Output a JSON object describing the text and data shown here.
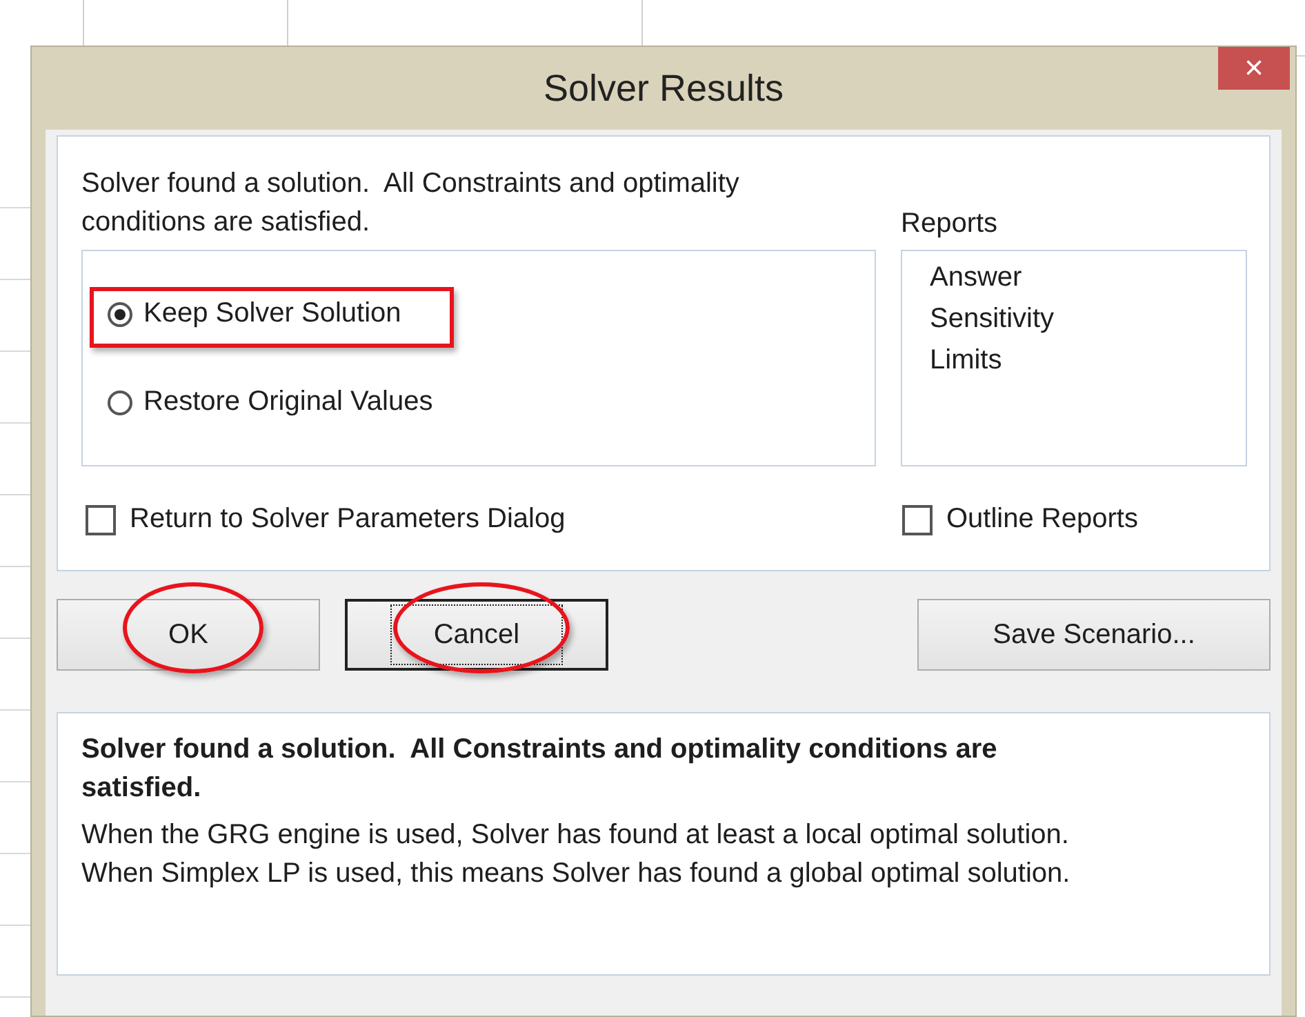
{
  "window": {
    "title": "Solver Results",
    "close": "×"
  },
  "message": "Solver found a solution.  All Constraints and optimality conditions are satisfied.",
  "options": [
    {
      "label": "Keep Solver Solution",
      "selected": true,
      "boxed": true
    },
    {
      "label": "Restore Original Values",
      "selected": false,
      "boxed": false
    }
  ],
  "reports": {
    "label": "Reports",
    "items": [
      "Answer",
      "Sensitivity",
      "Limits"
    ]
  },
  "checkboxes": [
    {
      "label": "Return to Solver Parameters Dialog",
      "checked": false
    },
    {
      "label": "Outline Reports",
      "checked": false
    }
  ],
  "buttons": [
    {
      "label": "OK",
      "focused": false,
      "circled": true
    },
    {
      "label": "Cancel",
      "focused": true,
      "circled": true
    },
    {
      "label": "Save Scenario...",
      "focused": false,
      "circled": false
    }
  ],
  "details": {
    "heading": "Solver found a solution.  All Constraints and optimality conditions are satisfied.",
    "body": "When the GRG engine is used, Solver has found at least a local optimal solution. When Simplex LP is used, this means Solver has found a global optimal solution."
  }
}
